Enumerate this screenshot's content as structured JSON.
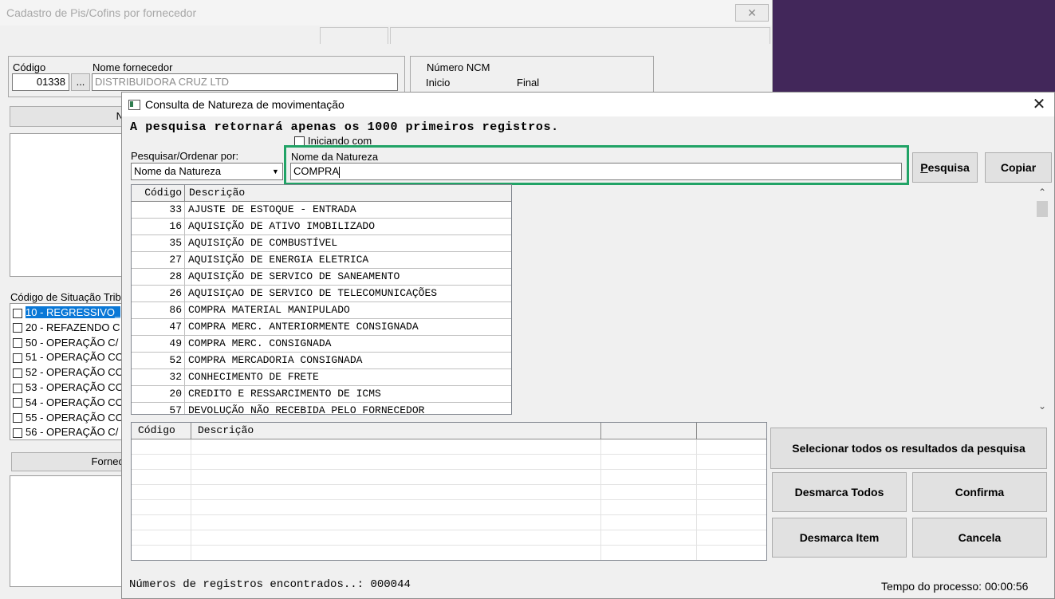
{
  "background_window": {
    "title": "Cadastro de Pis/Cofins por fornecedor",
    "close_glyph": "✕",
    "codigo_label": "Código",
    "codigo_value": "01338",
    "lookup_button": "...",
    "nome_fornecedor_label": "Nome fornecedor",
    "nome_fornecedor_value": "DISTRIBUIDORA CRUZ LTD",
    "ncm_group_label": "Número NCM",
    "ncm_inicio_label": "Inicio",
    "ncm_final_label": "Final",
    "partial_button_label": "N",
    "cst_label": "Código de Situação Trib",
    "cst_items": [
      "10 - REGRESSIVO_",
      "20 - REFAZENDO C",
      "50 - OPERAÇÃO C/",
      "51 - OPERAÇÃO CO",
      "52 - OPERAÇÃO CO",
      "53 - OPERAÇÃO CO",
      "54 - OPERAÇÃO CO",
      "55 - OPERAÇÃO CO",
      "56 - OPERAÇÃO C/"
    ],
    "fornec_button": "Fornec"
  },
  "dialog": {
    "title": "Consulta de Natureza de movimentação",
    "close_glyph": "✕",
    "notice": "A pesquisa retornará apenas os 1000 primeiros registros.",
    "iniciando_com_label": "Iniciando com",
    "pesquisar_label": "Pesquisar/Ordenar por:",
    "pesquisar_value": "Nome da Natureza",
    "search_field_label": "Nome da Natureza",
    "search_value": "COMPRA",
    "pesquisa_button": "Pesquisa",
    "copiar_button": "Copiar",
    "results_headers": [
      "Código",
      "Descrição"
    ],
    "results": [
      {
        "codigo": "33",
        "descricao": "AJUSTE DE ESTOQUE - ENTRADA"
      },
      {
        "codigo": "16",
        "descricao": "AQUISIÇÃO DE ATIVO IMOBILIZADO"
      },
      {
        "codigo": "35",
        "descricao": "AQUISIÇÃO DE COMBUSTÍVEL"
      },
      {
        "codigo": "27",
        "descricao": "AQUISIÇÃO DE ENERGIA ELETRICA"
      },
      {
        "codigo": "28",
        "descricao": "AQUISIÇÃO DE SERVICO DE SANEAMENTO"
      },
      {
        "codigo": "26",
        "descricao": "AQUISIÇAO DE SERVICO DE TELECOMUNICAÇÕES"
      },
      {
        "codigo": "86",
        "descricao": "COMPRA MATERIAL MANIPULADO"
      },
      {
        "codigo": "47",
        "descricao": "COMPRA MERC. ANTERIORMENTE CONSIGNADA"
      },
      {
        "codigo": "49",
        "descricao": "COMPRA MERC. CONSIGNADA"
      },
      {
        "codigo": "52",
        "descricao": "COMPRA MERCADORIA CONSIGNADA"
      },
      {
        "codigo": "32",
        "descricao": "CONHECIMENTO DE FRETE"
      },
      {
        "codigo": "20",
        "descricao": "CREDITO E RESSARCIMENTO DE ICMS"
      },
      {
        "codigo": "57",
        "descricao": "DEVOLUÇÃO NÃO RECEBIDA PELO FORNECEDOR"
      }
    ],
    "selected_headers": [
      "Código",
      "Descrição"
    ],
    "selecionar_todos_button": "Selecionar todos os resultados da pesquisa",
    "desmarca_todos_button": "Desmarca Todos",
    "confirma_button": "Confirma",
    "desmarca_item_button": "Desmarca Item",
    "cancela_button": "Cancela",
    "status_label": "Números de registros encontrados..:",
    "status_count": "000044",
    "tempo_label": "Tempo do processo:",
    "tempo_value": "00:00:56"
  },
  "colors": {
    "desktop": "#42275a",
    "highlight_box": "#21a366",
    "selection": "#0a78d7"
  }
}
